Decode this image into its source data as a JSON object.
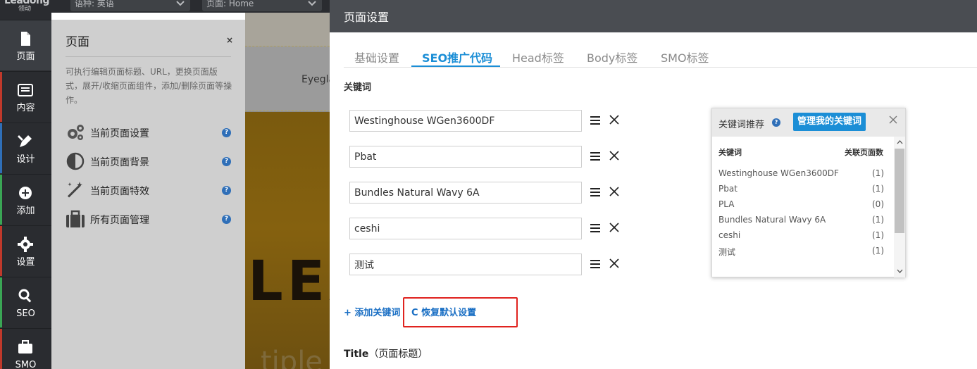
{
  "logo": {
    "text": "Leadong",
    "sub": "领动"
  },
  "nav": [
    {
      "label": "页面",
      "icon": "page-icon"
    },
    {
      "label": "内容",
      "icon": "content-icon"
    },
    {
      "label": "设计",
      "icon": "design-icon"
    },
    {
      "label": "添加",
      "icon": "add-icon"
    },
    {
      "label": "设置",
      "icon": "settings-icon"
    },
    {
      "label": "SEO",
      "icon": "search-icon"
    },
    {
      "label": "SMO",
      "icon": "briefcase-icon"
    }
  ],
  "topbar": {
    "language": "语种: 英语",
    "page": "页面: Home"
  },
  "page_panel": {
    "title": "页面",
    "close": "×",
    "description": "可执行编辑页面标题、URL，更换页面版式，展开/收缩页面组件，添加/删除页面等操作。",
    "items": [
      {
        "label": "当前页面设置",
        "icon": "gears-icon"
      },
      {
        "label": "当前页面背景",
        "icon": "contrast-icon"
      },
      {
        "label": "当前页面特效",
        "icon": "magic-wand-icon"
      },
      {
        "label": "所有页面管理",
        "icon": "briefcase-icon"
      }
    ],
    "help": "?"
  },
  "preview": {
    "heading": "Eyegla",
    "big": "LEA",
    "bottom": "tiple"
  },
  "dialog": {
    "title": "页面设置",
    "tabs": [
      "基础设置",
      "SEO推广代码",
      "Head标签",
      "Body标签",
      "SMO标签"
    ],
    "active_tab": "SEO推广代码",
    "keywords_label": "关键词",
    "keywords": [
      "Westinghouse WGen3600DF",
      "Pbat",
      "Bundles Natural Wavy 6A",
      "ceshi",
      "测试"
    ],
    "add_keyword": "+ 添加关键词",
    "restore_default": "C 恢复默认设置",
    "title_label": "Title",
    "title_label_suffix": "（页面标题）"
  },
  "recommend": {
    "title": "关键词推荐",
    "help": "?",
    "manage_button": "管理我的关键词",
    "col_keyword": "关键词",
    "col_count": "关联页面数",
    "rows": [
      {
        "keyword": "Westinghouse WGen3600DF",
        "count": "(1)"
      },
      {
        "keyword": "Pbat",
        "count": "(1)"
      },
      {
        "keyword": "PLA",
        "count": "(0)"
      },
      {
        "keyword": "Bundles Natural Wavy 6A",
        "count": "(1)"
      },
      {
        "keyword": "ceshi",
        "count": "(1)"
      },
      {
        "keyword": "测试",
        "count": "(1)"
      }
    ]
  },
  "colors": {
    "accent": "#1b8ed6",
    "nav_bg": "#2a2c30",
    "highlight": "#e0231f",
    "link": "#1a6fc4"
  }
}
